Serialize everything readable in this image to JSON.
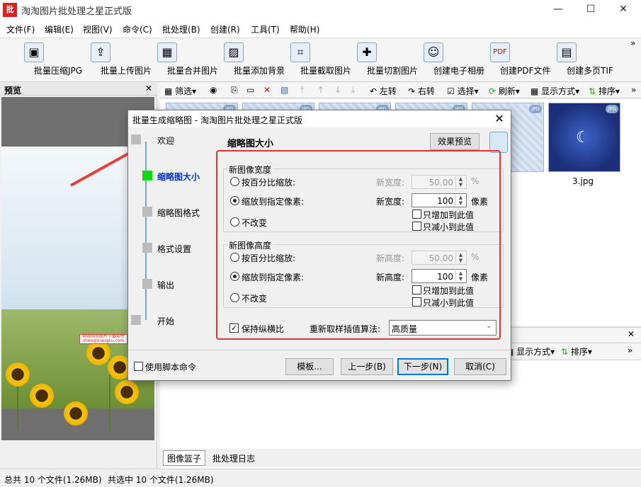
{
  "window": {
    "title": "淘淘图片批处理之星正式版",
    "icon_text": "批",
    "minimize": "—",
    "maximize": "☐",
    "close": "✕"
  },
  "menu": [
    "文件(F)",
    "编辑(E)",
    "视图(V)",
    "命令(C)",
    "批处理(B)",
    "创建(R)",
    "工具(T)",
    "帮助(H)"
  ],
  "toolbar": [
    "批量压缩JPG",
    "批量上传图片",
    "批量合并图片",
    "批量添加背景",
    "批量截取图片",
    "批量切割图片",
    "创建电子相册",
    "创建PDF文件",
    "创建多页TIF"
  ],
  "toolbar_more": "»",
  "preview": {
    "title": "预览",
    "close": "✕",
    "watermark": "神奇网页图片下载软件 shenqixiangsu.com"
  },
  "sec_toolbar": {
    "filter": "筛选▾",
    "rotate_left": "左转",
    "rotate_right": "右转",
    "select": "选择▾",
    "refresh": "刷新▾",
    "display": "显示方式▾",
    "sort": "排序▾",
    "more": "»"
  },
  "thumbnails": [
    {
      "label": "",
      "tag": "JPG"
    },
    {
      "label": "",
      "tag": "JPG"
    },
    {
      "label": "",
      "tag": "JPG"
    },
    {
      "label": "",
      "tag": "JPG"
    },
    {
      "label": "PG",
      "tag": "JPG"
    },
    {
      "label": "3.jpg",
      "tag": "JPG"
    }
  ],
  "bottom_toolbar": {
    "display": "显示方式▾",
    "sort": "排序▾",
    "close": "✕",
    "more": "»"
  },
  "bottom_tabs": [
    "图像篮子",
    "批处理日志"
  ],
  "status": {
    "total": "总共 10 个文件(1.26MB)",
    "selected": "共选中 10 个文件(1.26MB)"
  },
  "dialog": {
    "title": "批量生成缩略图 - 淘淘图片批处理之星正式版",
    "close": "✕",
    "steps": [
      {
        "label": "欢迎",
        "active": false
      },
      {
        "label": "缩略图大小",
        "active": true
      },
      {
        "label": "缩略图格式",
        "active": false
      },
      {
        "label": "格式设置",
        "active": false
      },
      {
        "label": "输出",
        "active": false
      },
      {
        "label": "开始",
        "active": false
      }
    ],
    "heading": "缩略图大小",
    "preview_button": "效果预览",
    "width_group": {
      "legend": "新图像宽度",
      "options": [
        "按百分比缩放:",
        "缩放到指定像素:",
        "不改变"
      ],
      "selected": 1,
      "pct_label": "新宽度:",
      "pct_value": "50.00",
      "pct_unit": "%",
      "px_label": "新宽度:",
      "px_value": "100",
      "px_unit": "像素",
      "only_increase": "只增加到此值",
      "only_decrease": "只减小到此值"
    },
    "height_group": {
      "legend": "新图像高度",
      "options": [
        "按百分比缩放:",
        "缩放到指定像素:",
        "不改变"
      ],
      "selected": 1,
      "pct_label": "新高度:",
      "pct_value": "50.00",
      "pct_unit": "%",
      "px_label": "新高度:",
      "px_value": "100",
      "px_unit": "像素",
      "only_increase": "只增加到此值",
      "only_decrease": "只减小到此值"
    },
    "keep_ratio": "保持纵横比",
    "keep_ratio_checked": true,
    "resample_label": "重新取样插值算法:",
    "resample_value": "高质量",
    "use_script": "使用脚本命令",
    "buttons": {
      "template": "模板...",
      "back": "上一步(B)",
      "next": "下一步(N)",
      "cancel": "取消(C)"
    }
  },
  "accent": {
    "highlight_box": "#e43535",
    "active_step": "#00dd00",
    "active_text": "#0033cc"
  }
}
